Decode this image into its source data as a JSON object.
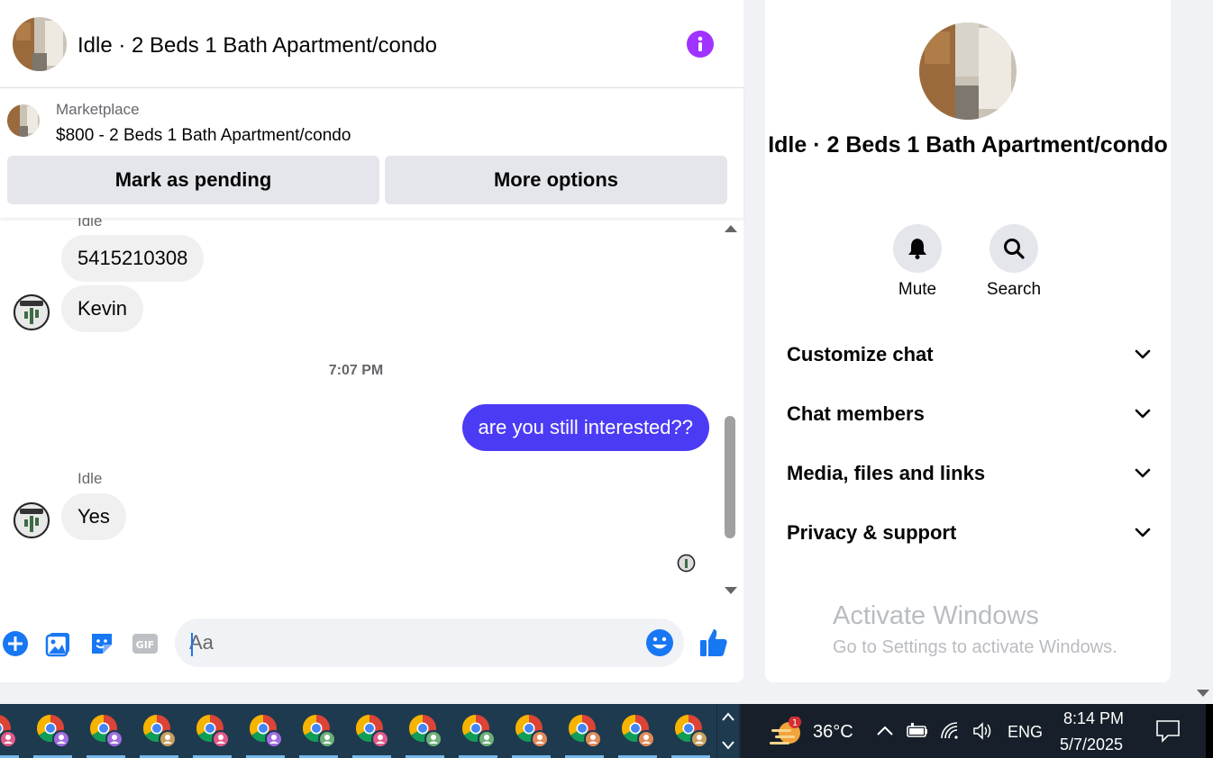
{
  "header": {
    "title": "Idle · 2 Beds 1 Bath Apartment/condo"
  },
  "listing": {
    "source": "Marketplace",
    "name": "$800 - 2 Beds 1 Bath Apartment/condo",
    "mark_pending_label": "Mark as pending",
    "more_options_label": "More options"
  },
  "messages": {
    "sender_top": "Idle",
    "msg1": "5415210308",
    "msg2": "Kevin",
    "time_divider": "7:07 PM",
    "outgoing": "are you still interested??",
    "sender_bottom": "Idle",
    "msg3": "Yes"
  },
  "composer": {
    "placeholder": "Aa",
    "value": ""
  },
  "side": {
    "title": "Idle · 2 Beds 1 Bath Apartment/condo",
    "mute_label": "Mute",
    "search_label": "Search",
    "rows": [
      "Customize chat",
      "Chat members",
      "Media, files and links",
      "Privacy & support"
    ],
    "watermark_title": "Activate Windows",
    "watermark_sub": "Go to Settings to activate Windows."
  },
  "taskbar": {
    "weather_badge": "1",
    "temperature": "36°C",
    "language": "ENG",
    "time": "8:14 PM",
    "date": "5/7/2025",
    "app_count": 14
  },
  "colors": {
    "accent_blue": "#1877f2",
    "outgoing_bubble": "#4c3bf5",
    "info_purple": "#a033ff"
  }
}
